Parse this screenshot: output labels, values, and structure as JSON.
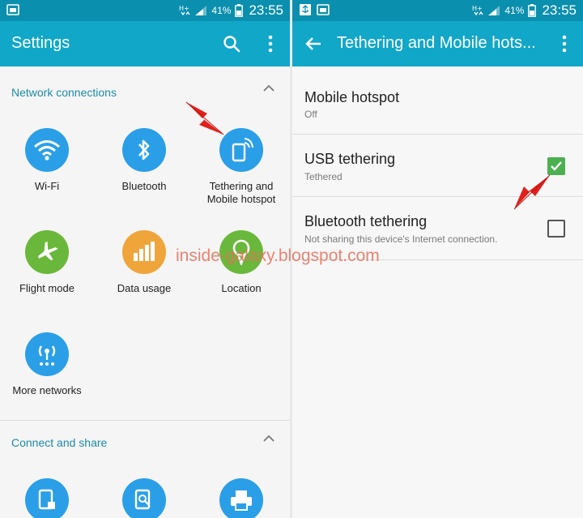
{
  "status_bar": {
    "battery": "41%",
    "time": "23:55"
  },
  "left_screen": {
    "title": "Settings",
    "sections": [
      {
        "header": "Network connections",
        "items": [
          {
            "label": "Wi-Fi",
            "color": "#2a9fe8",
            "icon": "wifi-icon"
          },
          {
            "label": "Bluetooth",
            "color": "#2a9fe8",
            "icon": "bluetooth-icon"
          },
          {
            "label": "Tethering and\nMobile hotspot",
            "color": "#2a9fe8",
            "icon": "hotspot-icon"
          },
          {
            "label": "Flight mode",
            "color": "#6ab83b",
            "icon": "airplane-icon"
          },
          {
            "label": "Data usage",
            "color": "#f0a53a",
            "icon": "data-usage-icon"
          },
          {
            "label": "Location",
            "color": "#6ab83b",
            "icon": "location-icon"
          },
          {
            "label": "More networks",
            "color": "#2a9fe8",
            "icon": "more-networks-icon"
          }
        ]
      },
      {
        "header": "Connect and share",
        "items": [
          {
            "label": "",
            "color": "#2a9fe8",
            "icon": "nfc-icon"
          },
          {
            "label": "",
            "color": "#2a9fe8",
            "icon": "device-search-icon"
          },
          {
            "label": "",
            "color": "#2a9fe8",
            "icon": "printer-icon"
          }
        ]
      }
    ]
  },
  "right_screen": {
    "title": "Tethering and Mobile hots...",
    "rows": [
      {
        "title": "Mobile hotspot",
        "subtitle": "Off",
        "checkbox": null
      },
      {
        "title": "USB tethering",
        "subtitle": "Tethered",
        "checkbox": true
      },
      {
        "title": "Bluetooth tethering",
        "subtitle": "Not sharing this device's Internet connection.",
        "checkbox": false
      }
    ]
  },
  "watermark": "inside-galaxy.blogspot.com",
  "colors": {
    "status_bar": "#0b8fae",
    "app_bar": "#11a7c9",
    "accent_text": "#1d8ba6",
    "checkbox_checked": "#4cb050",
    "annotation_arrow": "#e0201b"
  }
}
